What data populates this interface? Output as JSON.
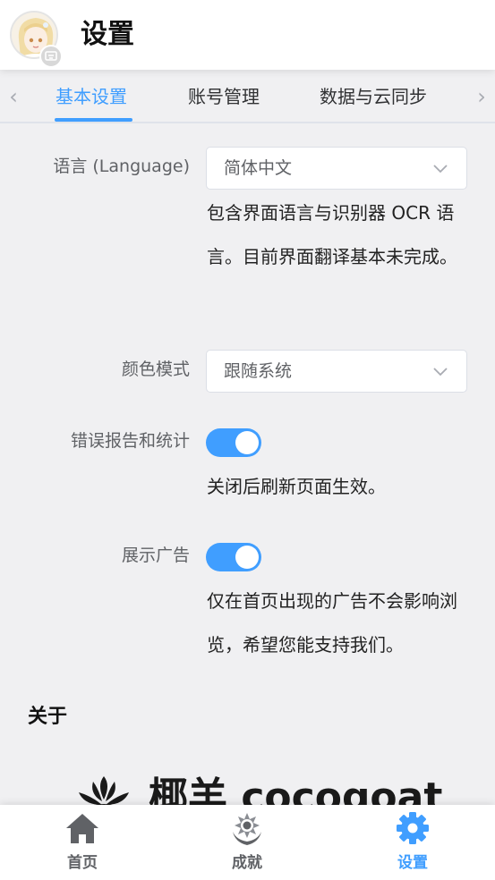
{
  "header": {
    "title": "设置"
  },
  "tabs": {
    "items": [
      {
        "label": "基本设置",
        "active": true
      },
      {
        "label": "账号管理",
        "active": false
      },
      {
        "label": "数据与云同步",
        "active": false
      }
    ],
    "prev_icon": "chevron-left-icon",
    "next_icon": "chevron-right-icon"
  },
  "settings": {
    "language": {
      "label": "语言 (Language)",
      "value": "简体中文",
      "hint": "包含界面语言与识别器 OCR 语言。目前界面翻译基本未完成。"
    },
    "color_mode": {
      "label": "颜色模式",
      "value": "跟随系统"
    },
    "error_report": {
      "label": "错误报告和统计",
      "enabled": true,
      "hint": "关闭后刷新页面生效。"
    },
    "show_ads": {
      "label": "展示广告",
      "enabled": true,
      "hint": "仅在首页出现的广告不会影响浏览，希望您能支持我们。"
    }
  },
  "about": {
    "title": "关于",
    "brand_text": "椰羊 cocogoat"
  },
  "bottom_nav": [
    {
      "label": "首页",
      "icon": "home-icon",
      "active": false
    },
    {
      "label": "成就",
      "icon": "achievement-icon",
      "active": false
    },
    {
      "label": "设置",
      "icon": "gear-icon",
      "active": true
    }
  ],
  "colors": {
    "accent": "#409eff",
    "background": "#f0f0f2",
    "text": "#303133"
  }
}
